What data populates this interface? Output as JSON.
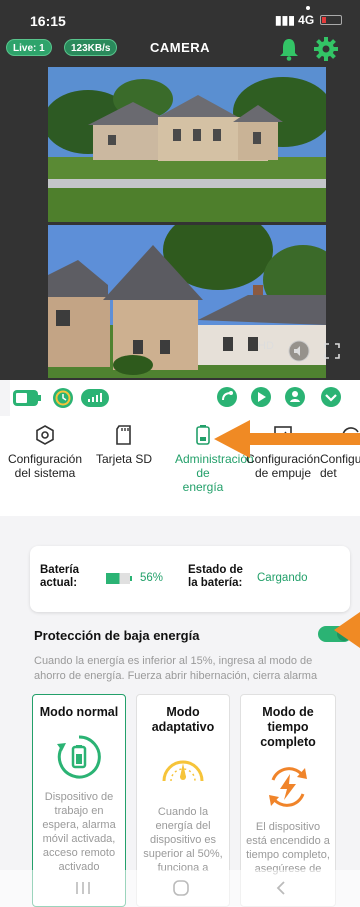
{
  "status": {
    "time": "16:15",
    "network": "4G"
  },
  "header": {
    "live": "Live: 1",
    "rate": "123KB/s",
    "title": "CAMERA"
  },
  "video": {
    "quality": "HD"
  },
  "tabs": [
    {
      "label": "Configuración del sistema"
    },
    {
      "label": "Tarjeta SD"
    },
    {
      "label": "Administración de energía",
      "active": true
    },
    {
      "label": "Configuración de empuje"
    },
    {
      "label": "Configu de det"
    }
  ],
  "battery": {
    "current_label": "Batería actual:",
    "percent": "56%",
    "level": 0.56,
    "state_label": "Estado de la batería:",
    "state": "Cargando"
  },
  "low_power": {
    "title": "Protección de baja energía",
    "enabled": true,
    "description": "Cuando la energía es inferior al 15%, ingresa al modo de ahorro de energía. Fuerza abrir hibernación, cierra alarma"
  },
  "modes": [
    {
      "title": "Modo normal",
      "desc": "Dispositivo de trabajo en espera, alarma móvil activada, acceso remoto activado",
      "selected": true,
      "icon": "battery-cycle-icon"
    },
    {
      "title": "Modo adaptativo",
      "desc": "Cuando la energía del dispositivo es superior al 50%, funciona a",
      "selected": false,
      "icon": "gauge-icon"
    },
    {
      "title": "Modo de tiempo completo",
      "desc": "El dispositivo está encendido a tiempo completo, asegúrese de",
      "selected": false,
      "icon": "lightning-cycle-icon"
    }
  ],
  "colors": {
    "accent": "#23a06a",
    "arrow": "#f08a24",
    "dark": "#333333"
  }
}
